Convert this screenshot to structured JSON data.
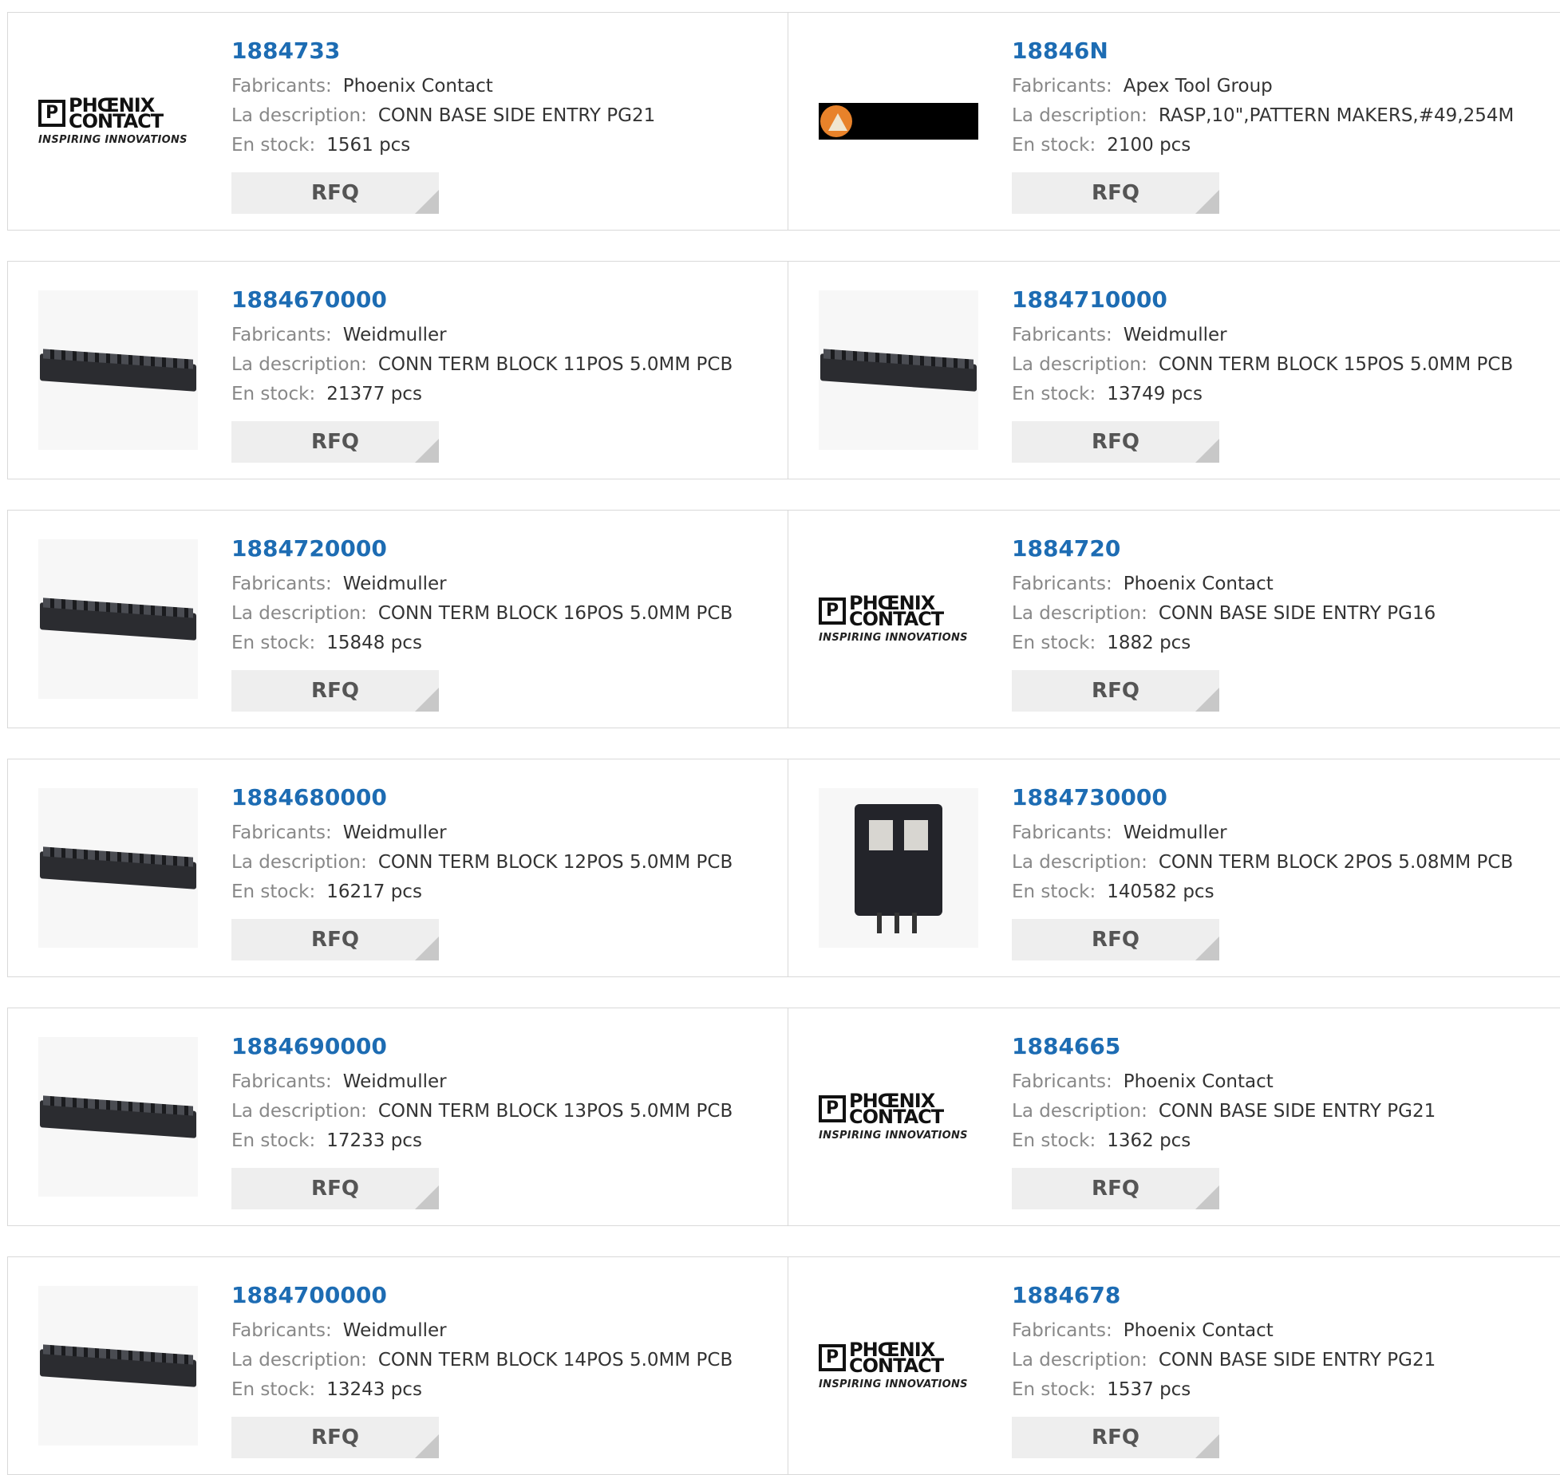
{
  "labels": {
    "manufacturer": "Fabricants:",
    "description": "La description:",
    "stock": "En stock:",
    "rfq": "RFQ"
  },
  "products": [
    {
      "pn": "1884733",
      "manufacturer": "Phoenix Contact",
      "description": "CONN BASE SIDE ENTRY PG21",
      "stock": "1561 pcs",
      "image": "phoenix-contact-logo"
    },
    {
      "pn": "18846N",
      "manufacturer": "Apex Tool Group",
      "description": "RASP,10\",PATTERN MAKERS,#49,254M",
      "stock": "2100 pcs",
      "image": "apex-tool-group-logo"
    },
    {
      "pn": "1884670000",
      "manufacturer": "Weidmuller",
      "description": "CONN TERM BLOCK 11POS 5.0MM PCB",
      "stock": "21377 pcs",
      "image": "terminal-block-photo"
    },
    {
      "pn": "1884710000",
      "manufacturer": "Weidmuller",
      "description": "CONN TERM BLOCK 15POS 5.0MM PCB",
      "stock": "13749 pcs",
      "image": "terminal-block-photo"
    },
    {
      "pn": "1884720000",
      "manufacturer": "Weidmuller",
      "description": "CONN TERM BLOCK 16POS 5.0MM PCB",
      "stock": "15848 pcs",
      "image": "terminal-block-photo"
    },
    {
      "pn": "1884720",
      "manufacturer": "Phoenix Contact",
      "description": "CONN BASE SIDE ENTRY PG16",
      "stock": "1882 pcs",
      "image": "phoenix-contact-logo"
    },
    {
      "pn": "1884680000",
      "manufacturer": "Weidmuller",
      "description": "CONN TERM BLOCK 12POS 5.0MM PCB",
      "stock": "16217 pcs",
      "image": "terminal-block-photo"
    },
    {
      "pn": "1884730000",
      "manufacturer": "Weidmuller",
      "description": "CONN TERM BLOCK 2POS 5.08MM PCB",
      "stock": "140582 pcs",
      "image": "two-position-block-photo"
    },
    {
      "pn": "1884690000",
      "manufacturer": "Weidmuller",
      "description": "CONN TERM BLOCK 13POS 5.0MM PCB",
      "stock": "17233 pcs",
      "image": "terminal-block-photo"
    },
    {
      "pn": "1884665",
      "manufacturer": "Phoenix Contact",
      "description": "CONN BASE SIDE ENTRY PG21",
      "stock": "1362 pcs",
      "image": "phoenix-contact-logo"
    },
    {
      "pn": "1884700000",
      "manufacturer": "Weidmuller",
      "description": "CONN TERM BLOCK 14POS 5.0MM PCB",
      "stock": "13243 pcs",
      "image": "terminal-block-photo"
    },
    {
      "pn": "1884678",
      "manufacturer": "Phoenix Contact",
      "description": "CONN BASE SIDE ENTRY PG21",
      "stock": "1537 pcs",
      "image": "phoenix-contact-logo"
    }
  ],
  "logos": {
    "phoenix_line1": "PHŒNIX",
    "phoenix_line2": "CONTACT",
    "phoenix_tagline": "INSPIRING INNOVATIONS"
  },
  "colors": {
    "part_number": "#1d6cb3",
    "label": "#888888",
    "rfq_bg": "#eeeeee"
  }
}
